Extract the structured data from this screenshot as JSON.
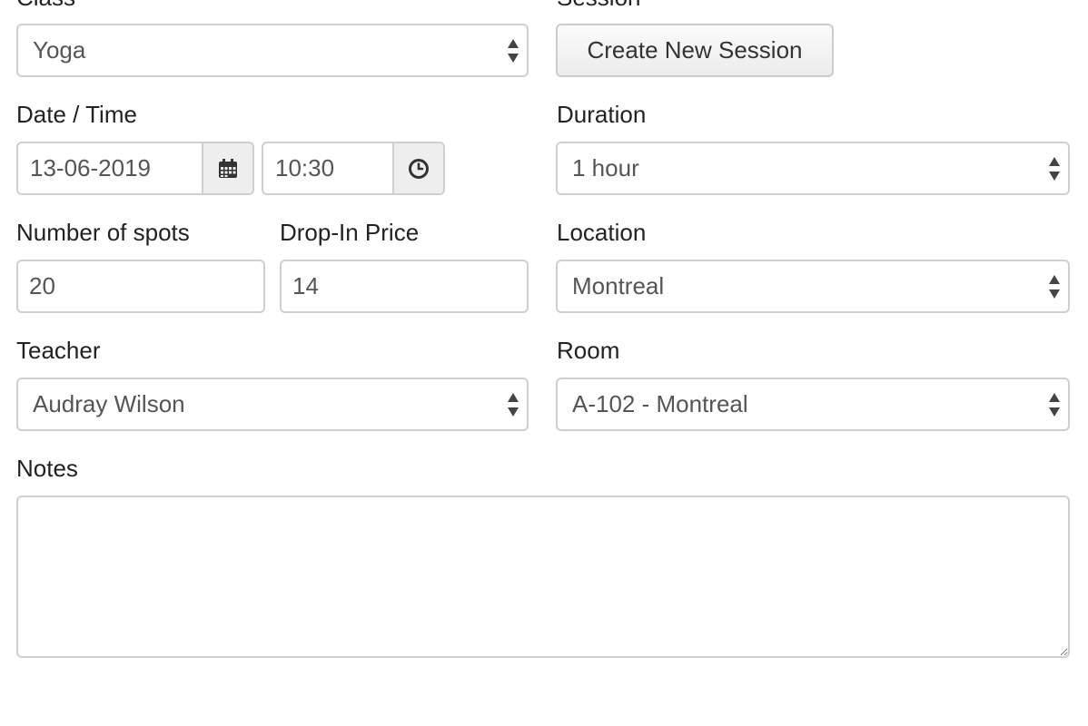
{
  "form": {
    "class": {
      "label": "Class",
      "value": "Yoga"
    },
    "session": {
      "label": "Session",
      "button_label": "Create New Session"
    },
    "datetime": {
      "label": "Date / Time",
      "date": "13-06-2019",
      "time": "10:30"
    },
    "duration": {
      "label": "Duration",
      "value": "1 hour"
    },
    "spots": {
      "label": "Number of spots",
      "value": "20"
    },
    "price": {
      "label": "Drop-In Price",
      "value": "14"
    },
    "location": {
      "label": "Location",
      "value": "Montreal"
    },
    "teacher": {
      "label": "Teacher",
      "value": "Audray Wilson"
    },
    "room": {
      "label": "Room",
      "value": "A-102 - Montreal"
    },
    "notes": {
      "label": "Notes",
      "value": ""
    }
  },
  "icons": {
    "date": "calendar-icon",
    "time": "clock-icon",
    "select": "select-arrows-icon"
  }
}
